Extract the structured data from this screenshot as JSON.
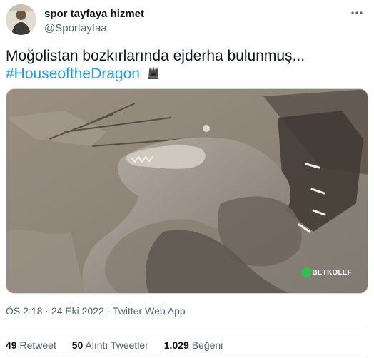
{
  "author": {
    "display_name": "spor tayfaya hizmet",
    "handle": "@Sportayfaa",
    "avatar_icon": "profile-photo"
  },
  "tweet": {
    "text_line1": "Moğolistan bozkırlarında ejderha bulunmuş...",
    "hashtag": "#HouseoftheDragon",
    "hashtag_emoji_icon": "iron-throne-icon"
  },
  "media": {
    "watermark": "BETKOLEF"
  },
  "meta": {
    "time": "ÖS 2:18",
    "date": "24 Eki 2022",
    "separator": "·",
    "source": "Twitter Web App"
  },
  "stats": {
    "retweets_count": "49",
    "retweets_label": "Retweet",
    "quotes_count": "50",
    "quotes_label": "Alıntı Tweetler",
    "likes_count": "1.029",
    "likes_label": "Beğeni"
  },
  "colors": {
    "link": "#1d9bf0",
    "secondary_text": "#536471",
    "primary_text": "#0f1419",
    "divider": "#eff3f4"
  }
}
